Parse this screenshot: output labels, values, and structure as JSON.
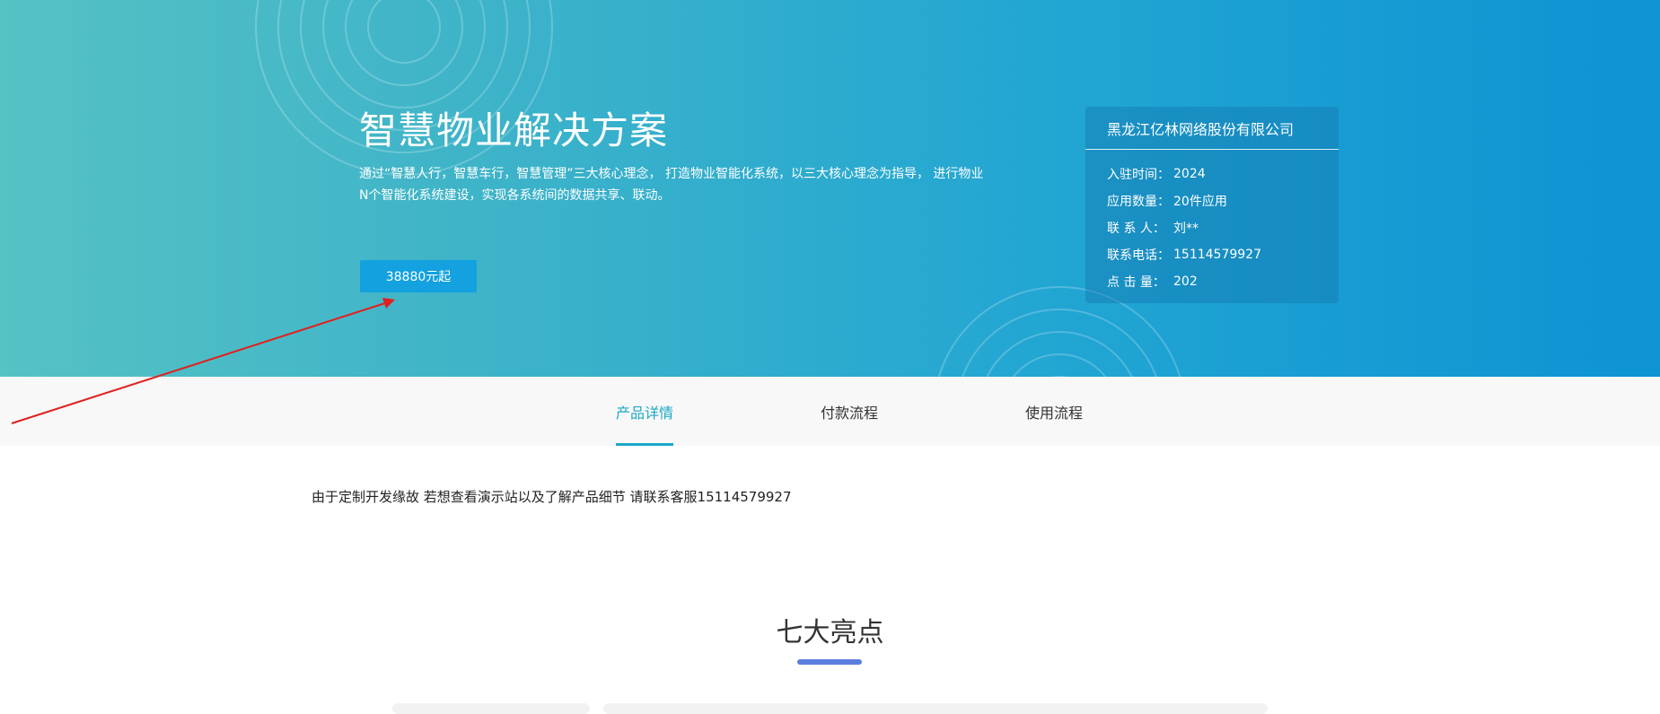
{
  "hero": {
    "title": "智慧物业解决方案",
    "description": "通过“智慧人行，智慧车行，智慧管理”三大核心理念，  打造物业智能化系统，以三大核心理念为指导，  进行物业N个智能化系统建设，实现各系统间的数据共享、联动。",
    "price_button": "38880元起"
  },
  "company": {
    "name": "黑龙江亿林网络股份有限公司",
    "info": [
      {
        "label": "入驻时间：",
        "value": "2024"
      },
      {
        "label": "应用数量：",
        "value": "20件应用"
      },
      {
        "label": "联 系 人：",
        "value": "刘**"
      },
      {
        "label": "联系电话：",
        "value": "15114579927"
      },
      {
        "label": "点 击 量：",
        "value": "202"
      }
    ]
  },
  "tabs": [
    {
      "label": "产品详情",
      "active": true
    },
    {
      "label": "付款流程",
      "active": false
    },
    {
      "label": "使用流程",
      "active": false
    }
  ],
  "notice": "由于定制开发缘故 若想查看演示站以及了解产品细节 请联系客服15114579927",
  "section": {
    "title": "七大亮点"
  },
  "colors": {
    "accent": "#1aa9c6",
    "price_button": "#13a1df",
    "section_underline": "#5b7ee0",
    "annotation_arrow": "#e02020"
  }
}
